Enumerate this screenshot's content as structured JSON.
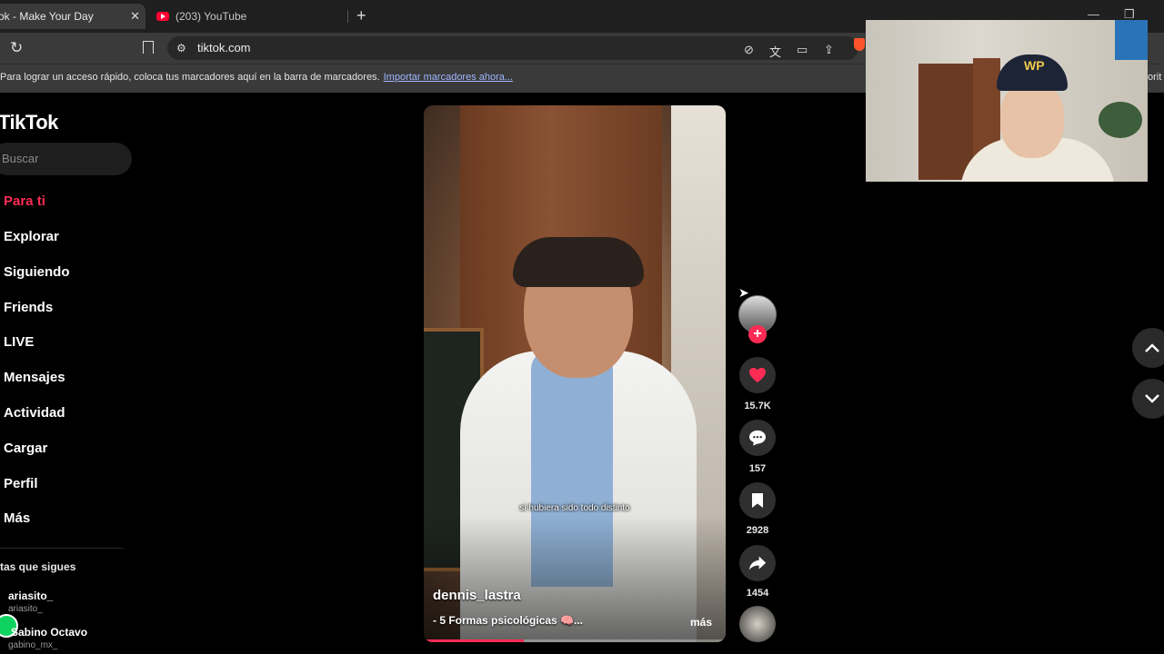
{
  "browser": {
    "tabs": [
      {
        "title": "ok - Make Your Day",
        "active": true
      },
      {
        "title": "(203) YouTube",
        "active": false
      }
    ],
    "url": "tiktok.com",
    "bookmarks_bar": {
      "message": "Para lograr un acceso rápido, coloca tus marcadores aquí en la barra de marcadores.",
      "import_link": "Importar marcadores ahora...",
      "right_fragment": "orit"
    }
  },
  "sidebar": {
    "logo": "TikTok",
    "search_placeholder": "Buscar",
    "nav": [
      {
        "label": "Para ti",
        "active": true
      },
      {
        "label": "Explorar"
      },
      {
        "label": "Siguiendo"
      },
      {
        "label": "Friends"
      },
      {
        "label": "LIVE"
      },
      {
        "label": "Mensajes"
      },
      {
        "label": "Actividad"
      },
      {
        "label": "Cargar"
      },
      {
        "label": "Perfil"
      },
      {
        "label": "Más"
      }
    ],
    "following_heading": "tas que sigues",
    "accounts": [
      {
        "name": "ariasito_",
        "handle": "ariasito_"
      },
      {
        "name": "Sabino Octavo",
        "handle": "gabino_mx_"
      }
    ]
  },
  "video": {
    "caption": "si hubiera sido todo distinto",
    "author": "dennis_lastra",
    "description": "- 5 Formas psicológicas 🧠...",
    "more_label": "más",
    "progress": 0.33
  },
  "actions": {
    "likes": "15.7K",
    "comments": "157",
    "saves": "2928",
    "shares": "1454"
  },
  "colors": {
    "accent": "#fe2c55",
    "background": "#000000",
    "sidebar_search": "#1e1e1e"
  }
}
